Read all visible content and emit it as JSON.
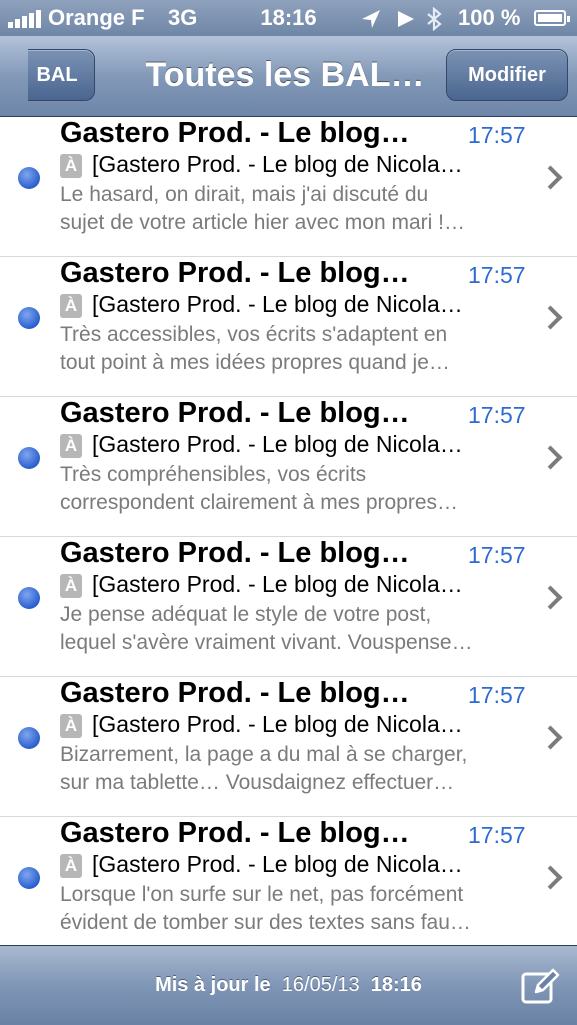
{
  "status_bar": {
    "carrier": "Orange F",
    "network": "3G",
    "time": "18:16",
    "battery": "100 %",
    "icons": [
      "signal-icon",
      "location-arrow-icon",
      "play-icon",
      "bluetooth-icon",
      "battery-icon"
    ]
  },
  "nav": {
    "back_label": "BAL",
    "title": "Toutes les BAL…",
    "edit_label": "Modifier"
  },
  "mails": [
    {
      "sender": "Gastero Prod. - Le blog…",
      "time": "17:57",
      "subject": "[Gastero Prod. - Le blog de Nicola…",
      "preview_1": "Le hasard, on dirait, mais j'ai discuté du",
      "preview_2": "sujet de votre article hier avec mon mari !…",
      "unread": true
    },
    {
      "sender": "Gastero Prod. - Le blog…",
      "time": "17:57",
      "subject": "[Gastero Prod. - Le blog de Nicola…",
      "preview_1": "Très accessibles, vos écrits s'adaptent en",
      "preview_2": "tout point à mes idées propres quand je…",
      "unread": true
    },
    {
      "sender": "Gastero Prod. - Le blog…",
      "time": "17:57",
      "subject": "[Gastero Prod. - Le blog de Nicola…",
      "preview_1": "Très compréhensibles, vos écrits",
      "preview_2": "correspondent clairement à mes propres…",
      "unread": true
    },
    {
      "sender": "Gastero Prod. - Le blog…",
      "time": "17:57",
      "subject": "[Gastero Prod. - Le blog de Nicola…",
      "preview_1": "Je pense adéquat le style de votre post,",
      "preview_2": "lequel s'avère vraiment vivant. Vouspense…",
      "unread": true
    },
    {
      "sender": "Gastero Prod. - Le blog…",
      "time": "17:57",
      "subject": "[Gastero Prod. - Le blog de Nicola…",
      "preview_1": "Bizarrement, la page a du mal à se charger,",
      "preview_2": "sur ma tablette… Vousdaignez effectuer…",
      "unread": true
    },
    {
      "sender": "Gastero Prod. - Le blog…",
      "time": "17:57",
      "subject": "[Gastero Prod. - Le blog de Nicola…",
      "preview_1": "Lorsque l'on surfe sur le net, pas forcément",
      "preview_2": "évident de tomber sur des textes sans fau…",
      "unread": true
    }
  ],
  "toolbar": {
    "updated_label": "Mis à jour le",
    "updated_date": "16/05/13",
    "updated_time": "18:16",
    "compose_icon": "compose-icon"
  },
  "colors": {
    "accent_time": "#2f6bd2",
    "unread_dot": "#2a5fcf",
    "bar": "#7f96b6"
  }
}
